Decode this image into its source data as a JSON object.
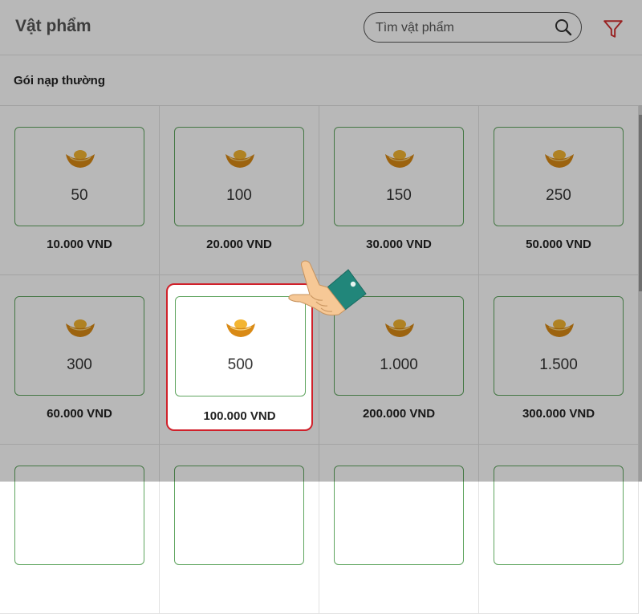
{
  "header": {
    "title": "Vật phẩm",
    "search_placeholder": "Tìm vật phẩm"
  },
  "icons": {
    "search": "search-icon",
    "filter": "filter-icon",
    "item": "gold-ingot-icon",
    "pointer": "pointing-hand-icon"
  },
  "section": {
    "title": "Gói nạp thường"
  },
  "packages": [
    {
      "amount": "50",
      "price": "10.000 VND"
    },
    {
      "amount": "100",
      "price": "20.000 VND"
    },
    {
      "amount": "150",
      "price": "30.000 VND"
    },
    {
      "amount": "250",
      "price": "50.000 VND"
    },
    {
      "amount": "300",
      "price": "60.000 VND"
    },
    {
      "amount": "500",
      "price": "100.000 VND"
    },
    {
      "amount": "1.000",
      "price": "200.000 VND"
    },
    {
      "amount": "1.500",
      "price": "300.000 VND"
    }
  ],
  "selected_package": "500",
  "colors": {
    "card_border": "#5fa55f",
    "highlight_border": "#d0202a",
    "filter_icon": "#d33030",
    "ingot": "#e8a020"
  }
}
